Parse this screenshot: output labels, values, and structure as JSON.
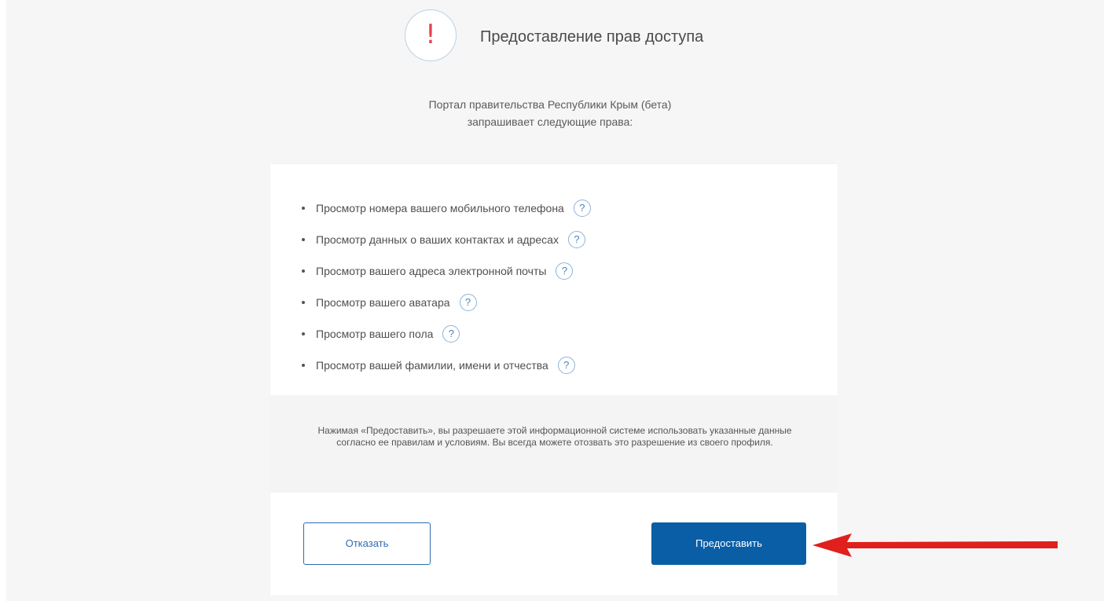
{
  "header": {
    "icon": "exclamation-icon",
    "icon_glyph": "!",
    "title": "Предоставление прав доступа"
  },
  "request": {
    "line1": "Портал правительства Республики Крым (бета)",
    "line2": "запрашивает следующие права:"
  },
  "permissions": [
    {
      "label": "Просмотр номера вашего мобильного телефона",
      "help": "?"
    },
    {
      "label": "Просмотр данных о ваших контактах и адресах",
      "help": "?"
    },
    {
      "label": "Просмотр вашего адреса электронной почты",
      "help": "?"
    },
    {
      "label": "Просмотр вашего аватара",
      "help": "?"
    },
    {
      "label": "Просмотр вашего пола",
      "help": "?"
    },
    {
      "label": "Просмотр вашей фамилии, имени и отчества",
      "help": "?"
    }
  ],
  "notice": {
    "text": "Нажимая «Предоставить», вы разрешаете этой информационной системе использовать указанные данные согласно ее правилам и условиям. Вы всегда можете отозвать это разрешение из своего профиля."
  },
  "actions": {
    "deny_label": "Отказать",
    "grant_label": "Предоставить"
  },
  "colors": {
    "accent": "#0a5ea6",
    "warning": "#e4434f",
    "annotation_arrow": "#e0201c"
  }
}
